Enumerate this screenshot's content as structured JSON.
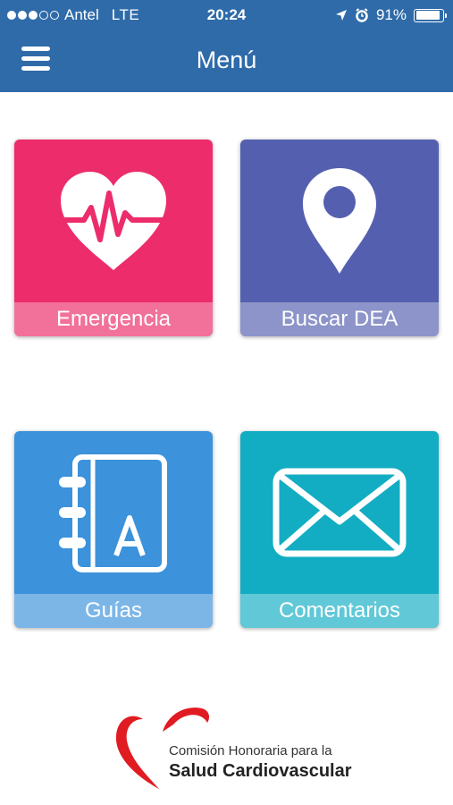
{
  "status_bar": {
    "carrier": "Antel",
    "network": "LTE",
    "time": "20:24",
    "battery": "91%",
    "battery_level": 0.91,
    "signal_bars_filled": 3,
    "signal_bars_total": 5
  },
  "navbar": {
    "title": "Menú",
    "menu_icon": "hamburger-icon",
    "background_color": "#2f6ba9"
  },
  "tiles": [
    {
      "label": "Emergencia",
      "icon": "heart-pulse-icon",
      "color": "#ec2c6b"
    },
    {
      "label": "Buscar DEA",
      "icon": "location-pin-icon",
      "color": "#5460af"
    },
    {
      "label": "Guías",
      "icon": "address-book-icon",
      "color": "#3c92db"
    },
    {
      "label": "Comentarios",
      "icon": "envelope-icon",
      "color": "#13adc3"
    }
  ],
  "footer_logo": {
    "line1": "Comisión Honoraria para la",
    "line2": "Salud Cardiovascular",
    "accent_color": "#e11b22"
  }
}
